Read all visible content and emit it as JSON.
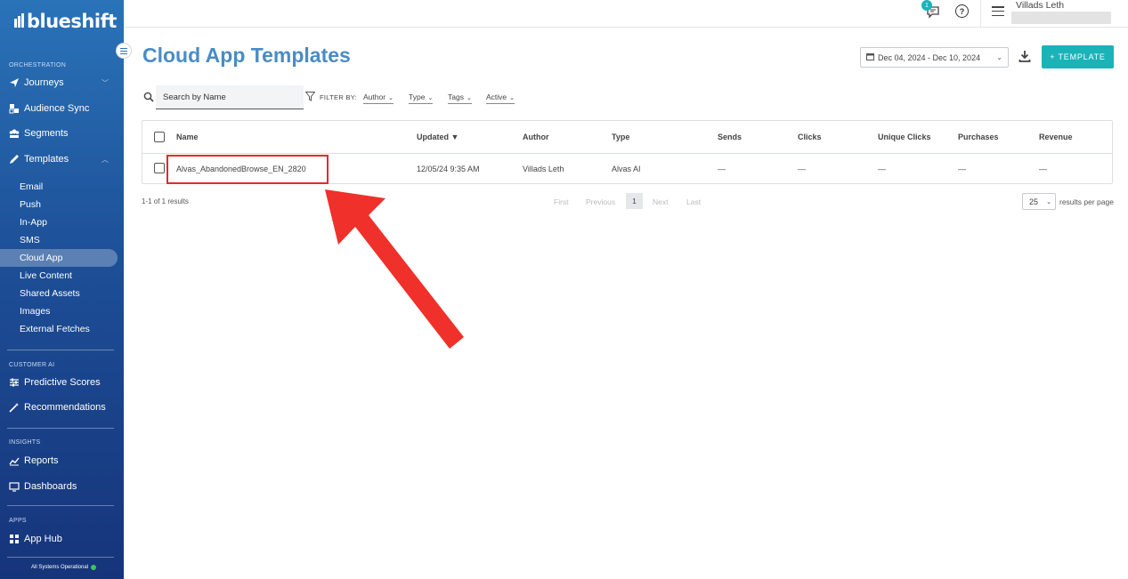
{
  "sidebar": {
    "logo": "blueshift",
    "sections": {
      "orchestration": "ORCHESTRATION",
      "customer_ai": "CUSTOMER AI",
      "insights": "INSIGHTS",
      "apps": "APPS"
    },
    "items": {
      "journeys": "Journeys",
      "audience_sync": "Audience Sync",
      "segments": "Segments",
      "templates": "Templates",
      "predictive_scores": "Predictive Scores",
      "recommendations": "Recommendations",
      "reports": "Reports",
      "dashboards": "Dashboards",
      "app_hub": "App Hub"
    },
    "template_subitems": [
      "Email",
      "Push",
      "In-App",
      "SMS",
      "Cloud App",
      "Live Content",
      "Shared Assets",
      "Images",
      "External Fetches"
    ],
    "active_subitem": "Cloud App",
    "status": "All Systems Operational",
    "status_color": "#3ec55c"
  },
  "topbar": {
    "notification_count": "1",
    "user_name": "Villads Leth"
  },
  "page": {
    "title": "Cloud App Templates",
    "date_range": "Dec 04, 2024 - Dec 10, 2024",
    "add_button": "+ TEMPLATE",
    "accent_color": "#1ab3b8",
    "title_color": "#4a8cc4"
  },
  "filters": {
    "search_placeholder": "Search by Name",
    "filter_by": "FILTER BY:",
    "author": "Author",
    "type": "Type",
    "tags": "Tags",
    "active": "Active"
  },
  "table": {
    "columns": {
      "name": "Name",
      "updated": "Updated ▼",
      "author": "Author",
      "type": "Type",
      "sends": "Sends",
      "clicks": "Clicks",
      "unique_clicks": "Unique Clicks",
      "purchases": "Purchases",
      "revenue": "Revenue"
    },
    "row": {
      "name": "Alvas_AbandonedBrowse_EN_2820",
      "updated": "12/05/24 9:35 AM",
      "author": "Villads Leth",
      "type": "Alvas AI",
      "sends": "—",
      "clicks": "—",
      "unique_clicks": "—",
      "purchases": "—",
      "revenue": "—"
    }
  },
  "pagination": {
    "results": "1-1 of 1 results",
    "first": "First",
    "previous": "Previous",
    "current": "1",
    "next": "Next",
    "last": "Last",
    "per_page_value": "25",
    "per_page_label": "results per page"
  },
  "annotation_color": "#e32a2a"
}
